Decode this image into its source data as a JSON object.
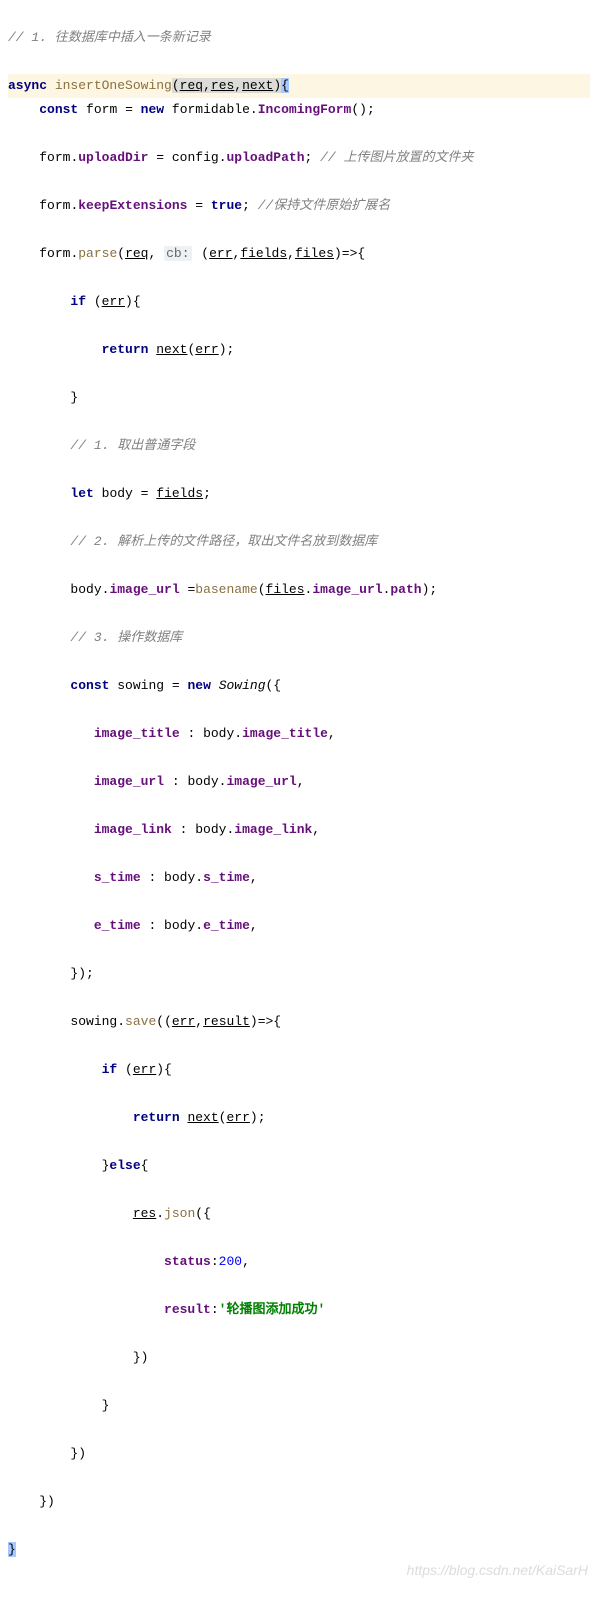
{
  "watermark": "https://blog.csdn.net/KaiSarH",
  "code": {
    "c1": "// 1. 往数据库中插入一条新记录",
    "async": "async",
    "fnName": "insertOneSowing",
    "req": "req",
    "res": "res",
    "next": "next",
    "const": "const",
    "form": "form",
    "new": "new",
    "formidable": "formidable",
    "IncomingForm": "IncomingForm",
    "uploadDir": "uploadDir",
    "config": "config",
    "uploadPath": "uploadPath",
    "c2": "// 上传图片放置的文件夹",
    "keepExtensions": "keepExtensions",
    "true": "true",
    "c3": "//保持文件原始扩展名",
    "parse": "parse",
    "cb": "cb:",
    "err": "err",
    "fields": "fields",
    "files": "files",
    "if": "if",
    "return": "return",
    "c4": "// 1. 取出普通字段",
    "let": "let",
    "body": "body",
    "c5": "// 2. 解析上传的文件路径，取出文件名放到数据库",
    "image_url": "image_url",
    "basename": "basename",
    "path": "path",
    "c6": "// 3. 操作数据库",
    "sowing": "sowing",
    "Sowing": "Sowing",
    "image_title": "image_title",
    "image_link": "image_link",
    "s_time": "s_time",
    "e_time": "e_time",
    "save": "save",
    "result": "result",
    "else": "else",
    "json": "json",
    "status": "status",
    "n200": "200",
    "resultKey": "result",
    "successStr": "'轮播图添加成功'"
  }
}
